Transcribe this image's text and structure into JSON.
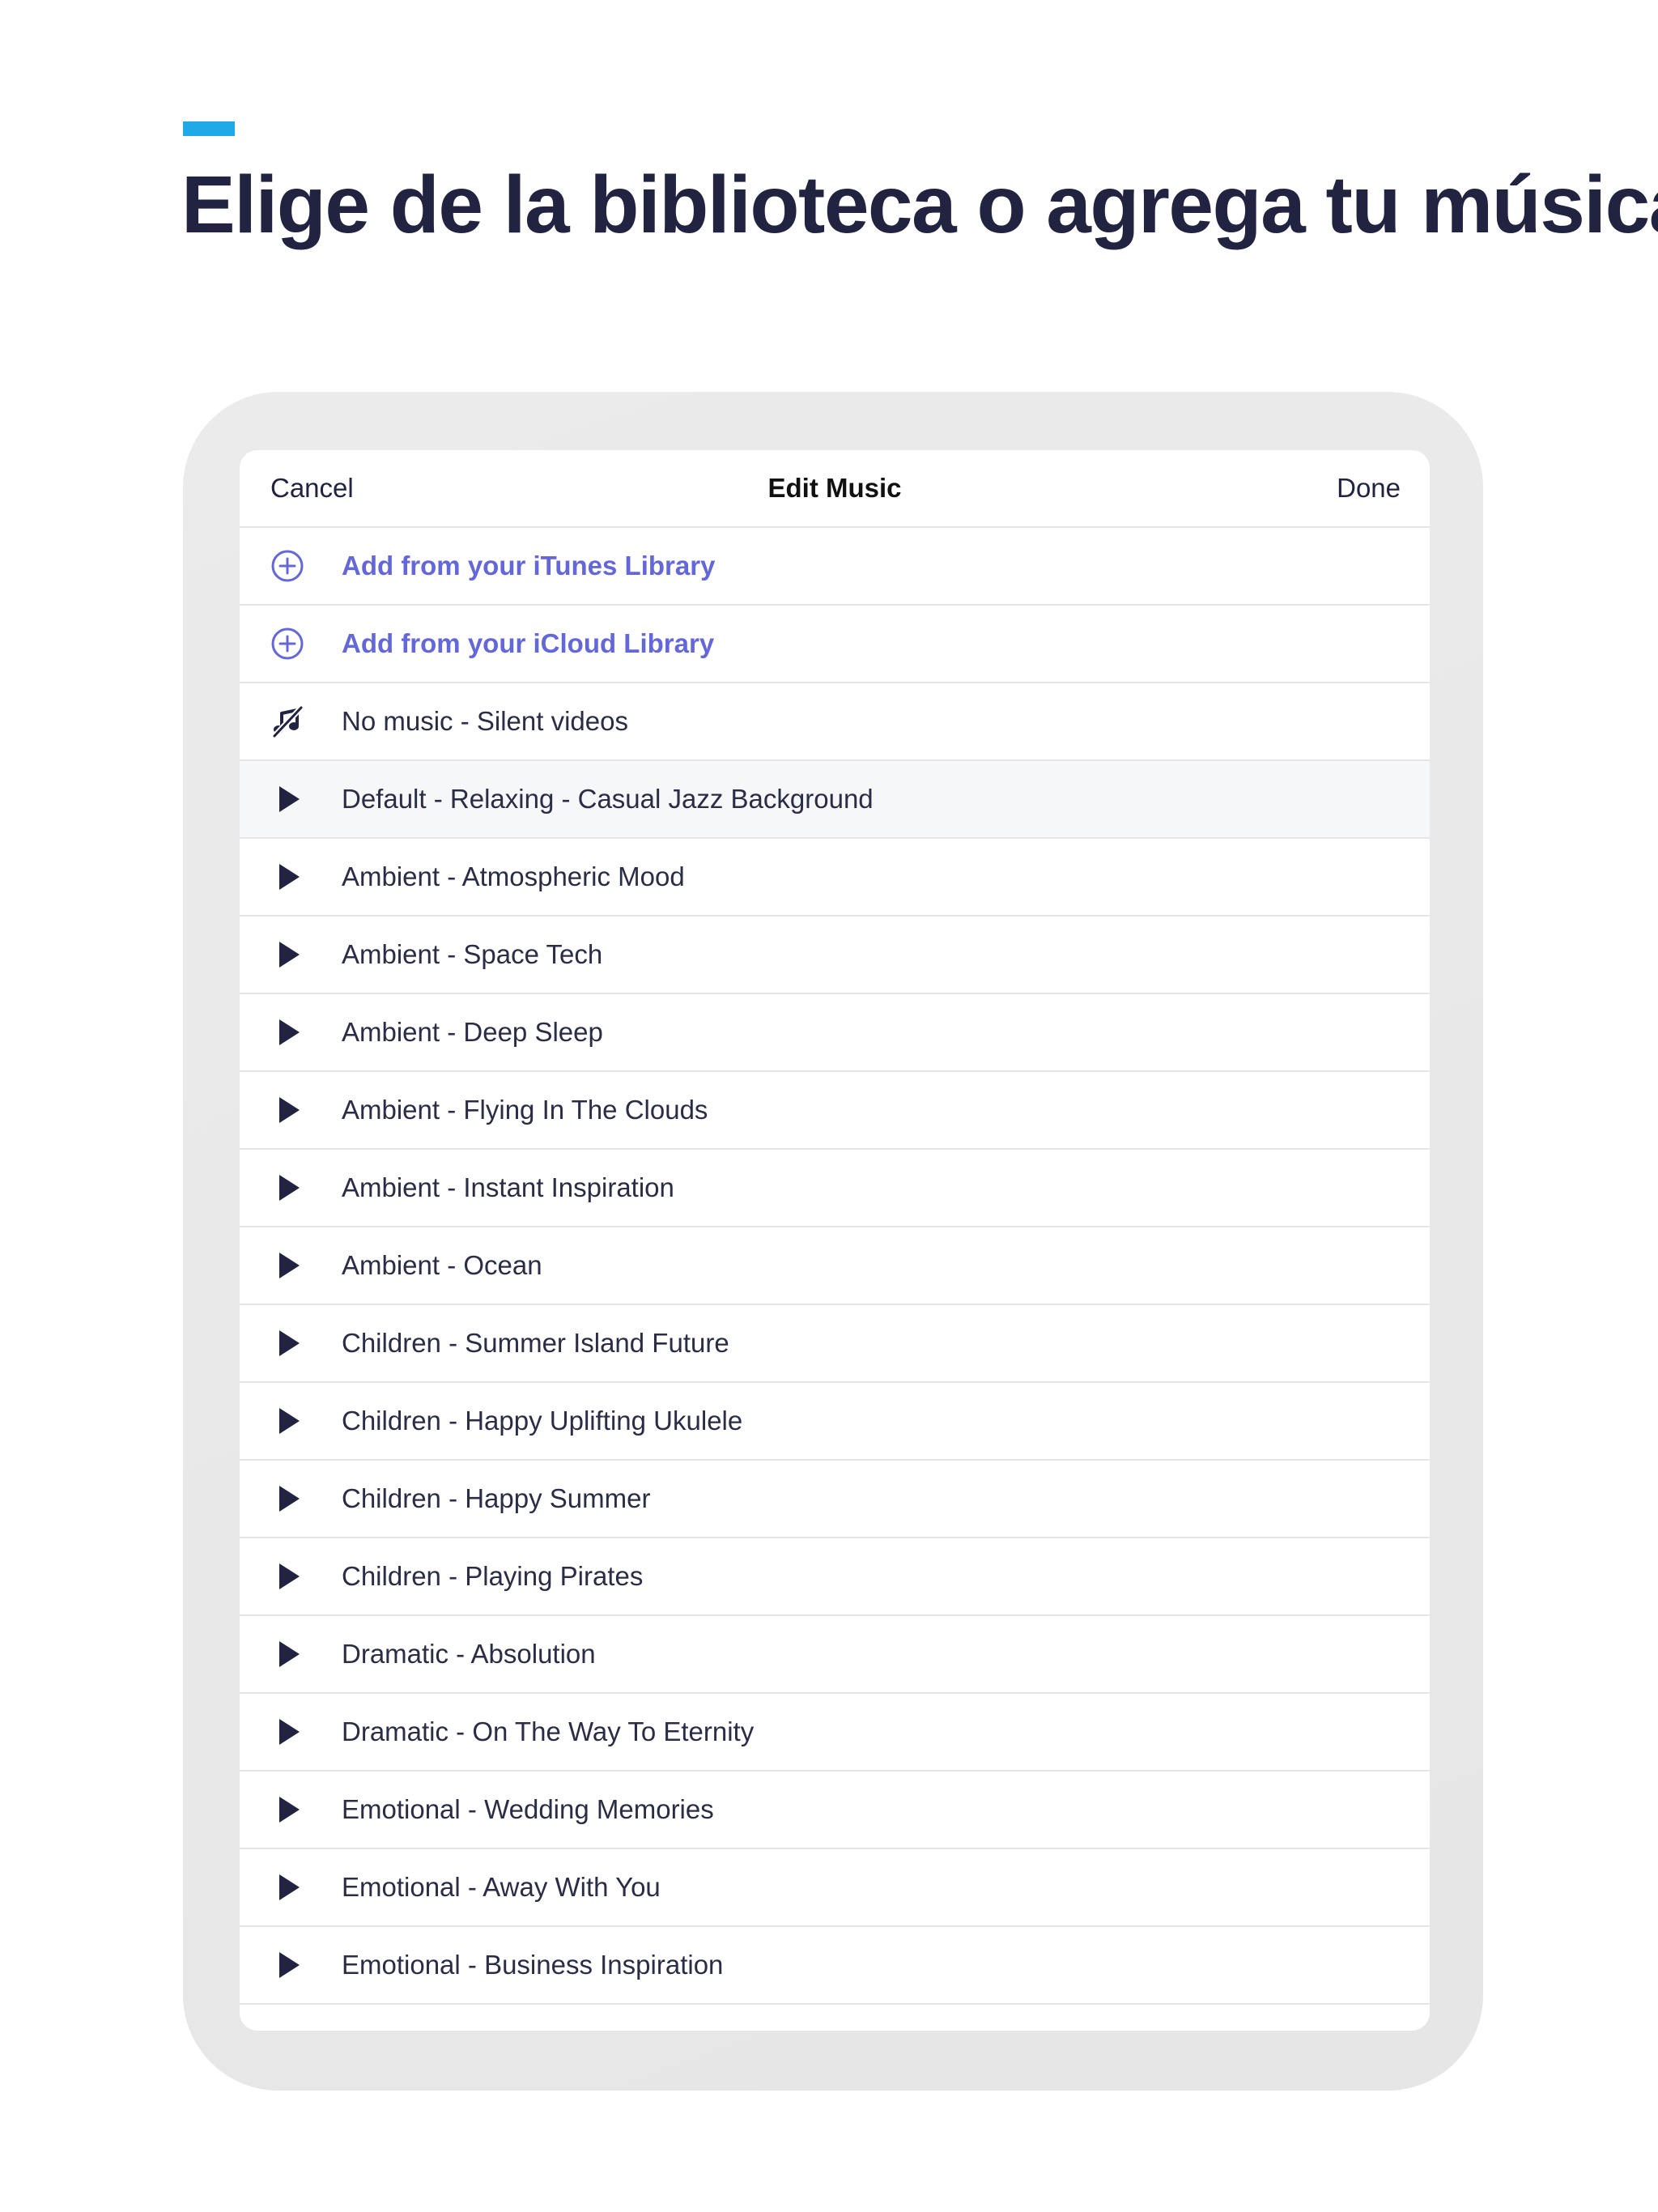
{
  "headline": "Elige de la biblioteca o agrega tu música",
  "colors": {
    "accent": "#1fa9e6",
    "headline": "#222340",
    "link": "#6467d8",
    "text": "#2b2c45",
    "device_frame": "#e8e8e8"
  },
  "nav": {
    "cancel_label": "Cancel",
    "title": "Edit Music",
    "done_label": "Done"
  },
  "actions": [
    {
      "label": "Add from your iTunes Library",
      "icon": "plus-circle-icon"
    },
    {
      "label": "Add from your iCloud Library",
      "icon": "plus-circle-icon"
    },
    {
      "label": "No music - Silent videos",
      "icon": "music-off-icon"
    }
  ],
  "tracks": [
    {
      "label": "Default - Relaxing - Casual Jazz Background",
      "icon": "play-icon",
      "selected": true
    },
    {
      "label": "Ambient - Atmospheric Mood",
      "icon": "play-icon"
    },
    {
      "label": "Ambient - Space Tech",
      "icon": "play-icon"
    },
    {
      "label": "Ambient - Deep Sleep",
      "icon": "play-icon"
    },
    {
      "label": "Ambient - Flying In The Clouds",
      "icon": "play-icon"
    },
    {
      "label": "Ambient - Instant Inspiration",
      "icon": "play-icon"
    },
    {
      "label": "Ambient - Ocean",
      "icon": "play-icon"
    },
    {
      "label": "Children - Summer Island Future",
      "icon": "play-icon"
    },
    {
      "label": "Children - Happy Uplifting Ukulele",
      "icon": "play-icon"
    },
    {
      "label": "Children - Happy Summer",
      "icon": "play-icon"
    },
    {
      "label": "Children - Playing Pirates",
      "icon": "play-icon"
    },
    {
      "label": "Dramatic - Absolution",
      "icon": "play-icon"
    },
    {
      "label": "Dramatic - On The Way To Eternity",
      "icon": "play-icon"
    },
    {
      "label": "Emotional - Wedding Memories",
      "icon": "play-icon"
    },
    {
      "label": "Emotional - Away With You",
      "icon": "play-icon"
    },
    {
      "label": "Emotional - Business Inspiration",
      "icon": "play-icon"
    }
  ]
}
